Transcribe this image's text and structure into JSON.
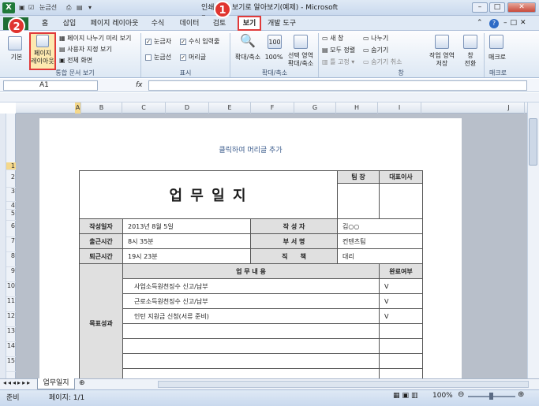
{
  "window": {
    "title": "인쇄 미리 보기로 알아보기(예제) - Microsoft Excel",
    "app_icon": "X"
  },
  "qat": {
    "label": "눈금선"
  },
  "tabs": [
    {
      "label": "홈"
    },
    {
      "label": "삽입"
    },
    {
      "label": "페이지 레이아웃"
    },
    {
      "label": "수식"
    },
    {
      "label": "데이터"
    },
    {
      "label": "검토"
    },
    {
      "label": "보기"
    },
    {
      "label": "개발 도구"
    }
  ],
  "file_tab": {
    "label": "파일"
  },
  "callouts": {
    "one": "1",
    "two": "2"
  },
  "ribbon": {
    "workbook_views": {
      "normal": "기본",
      "page_layout": "페이지\n레이아웃",
      "page_break": "페이지 나누기 미리 보기",
      "custom_views": "사용자 지정 보기",
      "full_screen": "전체 화면",
      "group": "통합 문서 보기"
    },
    "show": {
      "ruler": "눈금자",
      "formula_bar": "수식 입력줄",
      "gridlines": "눈금선",
      "headings": "머리글",
      "group": "표시"
    },
    "zoom": {
      "zoom": "확대/축소",
      "hundred": "100%",
      "selection": "선택 영역\n확대/축소",
      "group": "확대/축소"
    },
    "window": {
      "new": "새 창",
      "arrange": "모두 정렬",
      "freeze": "틀 고정",
      "split": "나누기",
      "hide": "숨기기",
      "unhide": "숨기기 취소",
      "save_ws": "작업 영역\n저장",
      "switch": "창\n전환",
      "group": "창"
    },
    "macros": {
      "label": "매크로",
      "group": "매크로"
    }
  },
  "formula_bar": {
    "name_box": "A1",
    "fx": "fx",
    "value": ""
  },
  "columns": [
    "A",
    "B",
    "C",
    "D",
    "E",
    "F",
    "G",
    "H",
    "I",
    "J"
  ],
  "rows": [
    "1",
    "2",
    "3",
    "4",
    "5",
    "6",
    "7",
    "8",
    "9",
    "10",
    "11",
    "12",
    "13",
    "14",
    "15"
  ],
  "page": {
    "header_prompt": "클릭하여 머리글 추가"
  },
  "document": {
    "title": "업 무 일 지",
    "approval": {
      "team_lead": "팀 장",
      "ceo": "대표이사"
    },
    "info": [
      {
        "label": "작성일자",
        "value": "2013년 8월 5일",
        "label2": "작 성 자",
        "value2": "김○○"
      },
      {
        "label": "출근시간",
        "value": "8시 35분",
        "label2": "부 서 명",
        "value2": "컨텐츠팀"
      },
      {
        "label": "퇴근시간",
        "value": "19시 23분",
        "label2": "직　　책",
        "value2": "대리"
      }
    ],
    "section_label": "목표성과",
    "tasks_header": "업 무 내 용",
    "done_header": "완료여부",
    "tasks": [
      {
        "task": "사업소득원천징수 신고/납부",
        "done": "V"
      },
      {
        "task": "근로소득원천징수 신고/납부",
        "done": "V"
      },
      {
        "task": "인턴 지원금 신청(서류 준비)",
        "done": "V"
      },
      {
        "task": "",
        "done": ""
      },
      {
        "task": "",
        "done": ""
      },
      {
        "task": "",
        "done": ""
      },
      {
        "task": "",
        "done": ""
      }
    ]
  },
  "sheet": {
    "tab": "업무일지"
  },
  "status": {
    "ready": "준비",
    "page": "페이지: 1/1",
    "zoom": "100%"
  }
}
